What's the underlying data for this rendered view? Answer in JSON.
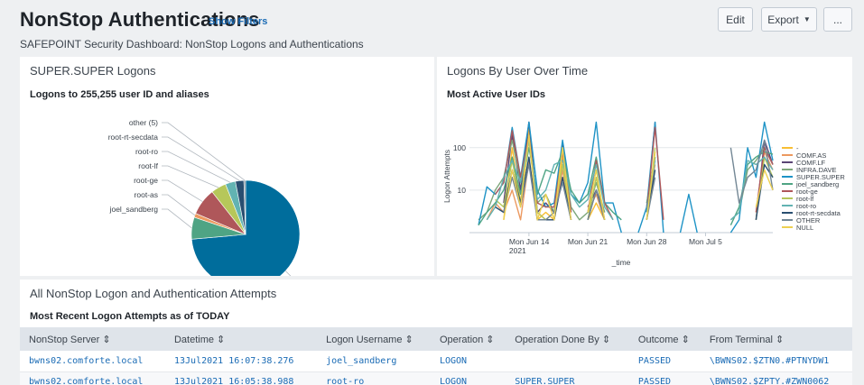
{
  "header": {
    "title": "NonStop Authentications",
    "show_filters": "Show Filters",
    "subtitle": "SAFEPOINT Security Dashboard: NonStop Logons and Authentications",
    "edit_label": "Edit",
    "export_label": "Export",
    "more_label": "..."
  },
  "panels": {
    "logons": {
      "title": "SUPER.SUPER Logons",
      "subtitle": "Logons to 255,255 user ID and aliases"
    },
    "over_time": {
      "title": "Logons By User Over Time",
      "subtitle": "Most Active User IDs"
    },
    "attempts": {
      "title": "All NonStop Logon and Authentication Attempts",
      "subtitle": "Most Recent Logon Attempts as of TODAY"
    }
  },
  "chart_data": [
    {
      "type": "pie",
      "title": "Logons to 255,255 user ID and aliases",
      "slices": [
        {
          "label": "SUPER.SUPER",
          "value": 73,
          "color": "#006d9c"
        },
        {
          "label": "joel_sandberg",
          "value": 6.5,
          "color": "#4fa484"
        },
        {
          "label": "root-as",
          "value": 1.2,
          "color": "#ec9960"
        },
        {
          "label": "root-ge",
          "value": 8,
          "color": "#af575a"
        },
        {
          "label": "root-lf",
          "value": 4.5,
          "color": "#b6c75a"
        },
        {
          "label": "root-ro",
          "value": 3,
          "color": "#62b3b2"
        },
        {
          "label": "root-rt-secdata",
          "value": 2.5,
          "color": "#294e70"
        },
        {
          "label": "other (5)",
          "value": 0.5,
          "color": "#738795"
        }
      ]
    },
    {
      "type": "line",
      "title": "Most Active User IDs",
      "xlabel": "_time",
      "ylabel": "Logon Attempts",
      "yscale": "log",
      "ylim": [
        1,
        450
      ],
      "yticks": [
        "10",
        "100"
      ],
      "xticks": [
        "Mon Jun 14\n2021",
        "Mon Jun 21",
        "Mon Jun 28",
        "Mon Jul 5"
      ],
      "x": [
        "Jun 8",
        "Jun 9",
        "Jun 10",
        "Jun 11",
        "Jun 12",
        "Jun 13",
        "Jun 14",
        "Jun 15",
        "Jun 16",
        "Jun 17",
        "Jun 18",
        "Jun 19",
        "Jun 20",
        "Jun 21",
        "Jun 22",
        "Jun 23",
        "Jun 24",
        "Jun 25",
        "Jun 26",
        "Jun 27",
        "Jun 28",
        "Jun 29",
        "Jun 30",
        "Jul 1",
        "Jul 2",
        "Jul 3",
        "Jul 4",
        "Jul 5",
        "Jul 6",
        "Jul 7",
        "Jul 8",
        "Jul 9",
        "Jul 10",
        "Jul 11",
        "Jul 12",
        "Jul 13"
      ],
      "series": [
        {
          "name": "-",
          "color": "#f8be34",
          "values": [
            null,
            null,
            null,
            2,
            100,
            5,
            300,
            2,
            3,
            2,
            60,
            3,
            null,
            2,
            5,
            2,
            null,
            null,
            null,
            null,
            2,
            80,
            null,
            null,
            null,
            null,
            null,
            null,
            null,
            null,
            null,
            null,
            null,
            null,
            2,
            null
          ]
        },
        {
          "name": "COMF.AS",
          "color": "#ec9960",
          "values": [
            null,
            2,
            5,
            3,
            10,
            2,
            50,
            3,
            2,
            2,
            30,
            2,
            null,
            3,
            8,
            2,
            null,
            null,
            null,
            null,
            3,
            40,
            null,
            null,
            null,
            null,
            null,
            null,
            null,
            null,
            null,
            null,
            null,
            3,
            80,
            30
          ]
        },
        {
          "name": "COMF.LF",
          "color": "#5a4575",
          "values": [
            null,
            null,
            null,
            5,
            200,
            10,
            400,
            3,
            5,
            3,
            120,
            3,
            null,
            4,
            10,
            3,
            null,
            null,
            null,
            null,
            3,
            400,
            null,
            null,
            null,
            null,
            null,
            null,
            null,
            null,
            null,
            null,
            null,
            2,
            150,
            40
          ]
        },
        {
          "name": "INFRA.DAVE",
          "color": "#7ea77b",
          "values": [
            2,
            3,
            10,
            20,
            150,
            15,
            200,
            5,
            8,
            3,
            100,
            4,
            2,
            3,
            15,
            3,
            null,
            null,
            null,
            null,
            4,
            60,
            null,
            null,
            null,
            null,
            null,
            null,
            null,
            null,
            2,
            3,
            30,
            50,
            100,
            40
          ]
        },
        {
          "name": "SUPER.SUPER",
          "color": "#1e93c6",
          "values": [
            1.5,
            12,
            8,
            15,
            300,
            20,
            400,
            10,
            4,
            5,
            150,
            8,
            5,
            15,
            400,
            5,
            5,
            1,
            null,
            1,
            4,
            400,
            1,
            null,
            1,
            8,
            1,
            null,
            null,
            null,
            1,
            2,
            100,
            20,
            400,
            50
          ]
        },
        {
          "name": "joel_sandberg",
          "color": "#4fa484",
          "values": [
            1.5,
            3,
            5,
            10,
            60,
            8,
            100,
            8,
            30,
            25,
            80,
            10,
            5,
            8,
            60,
            5,
            3,
            2,
            null,
            null,
            5,
            60,
            null,
            null,
            null,
            null,
            null,
            null,
            null,
            null,
            1.5,
            4,
            40,
            60,
            80,
            70
          ]
        },
        {
          "name": "root-ge",
          "color": "#af575a",
          "values": [
            null,
            null,
            8,
            15,
            250,
            20,
            200,
            5,
            4,
            4,
            80,
            3,
            null,
            3,
            50,
            5,
            2,
            null,
            null,
            null,
            3,
            300,
            2,
            null,
            null,
            null,
            null,
            null,
            null,
            null,
            null,
            null,
            null,
            3,
            100,
            40
          ]
        },
        {
          "name": "root-lf",
          "color": "#b6c75a",
          "values": [
            null,
            null,
            6,
            4,
            50,
            5,
            150,
            3,
            2,
            3,
            40,
            2,
            null,
            2,
            20,
            2,
            null,
            null,
            null,
            null,
            2,
            100,
            null,
            null,
            null,
            null,
            null,
            null,
            null,
            null,
            null,
            null,
            null,
            2,
            60,
            20
          ]
        },
        {
          "name": "root-ro",
          "color": "#62b3b2",
          "values": [
            null,
            2,
            4,
            20,
            50,
            15,
            150,
            6,
            10,
            40,
            50,
            8,
            4,
            6,
            40,
            4,
            2,
            null,
            null,
            null,
            3,
            50,
            null,
            null,
            null,
            null,
            null,
            null,
            null,
            null,
            2,
            3,
            50,
            40,
            60,
            30
          ]
        },
        {
          "name": "root-rt-secdata",
          "color": "#294e70",
          "values": [
            null,
            null,
            4,
            3,
            30,
            5,
            60,
            2,
            2,
            2,
            20,
            2,
            null,
            2,
            10,
            2,
            null,
            null,
            null,
            null,
            2,
            30,
            null,
            null,
            null,
            null,
            null,
            null,
            null,
            null,
            null,
            null,
            null,
            2,
            40,
            20
          ]
        },
        {
          "name": "OTHER",
          "color": "#738795",
          "values": [
            null,
            null,
            null,
            3,
            20,
            4,
            40,
            2,
            2,
            3,
            15,
            2,
            null,
            2,
            10,
            2,
            null,
            null,
            null,
            null,
            2,
            20,
            null,
            null,
            null,
            null,
            null,
            null,
            null,
            null,
            100,
            5,
            20,
            30,
            150,
            10
          ]
        },
        {
          "name": "NULL",
          "color": "#edd051",
          "values": [
            null,
            null,
            null,
            2,
            30,
            4,
            200,
            2,
            8,
            2,
            100,
            2,
            null,
            3,
            30,
            2,
            null,
            null,
            null,
            null,
            2,
            80,
            null,
            null,
            null,
            null,
            null,
            null,
            null,
            null,
            null,
            null,
            null,
            4,
            30,
            10
          ]
        }
      ]
    }
  ],
  "table": {
    "columns": [
      "NonStop Server ⇕",
      "Datetime ⇕",
      "Logon Username ⇕",
      "Operation ⇕",
      "Operation Done By ⇕",
      "Outcome ⇕",
      "From Terminal ⇕"
    ],
    "rows": [
      [
        "bwns02.comforte.local",
        "13Jul2021 16:07:38.276",
        "joel_sandberg",
        "LOGON",
        "",
        "PASSED",
        "\\BWNS02.$ZTN0.#PTNYDW1"
      ],
      [
        "bwns02.comforte.local",
        "13Jul2021 16:05:38.988",
        "root-ro",
        "LOGON",
        "SUPER.SUPER",
        "PASSED",
        "\\BWNS02.$ZPTY.#ZWN0062"
      ]
    ]
  }
}
